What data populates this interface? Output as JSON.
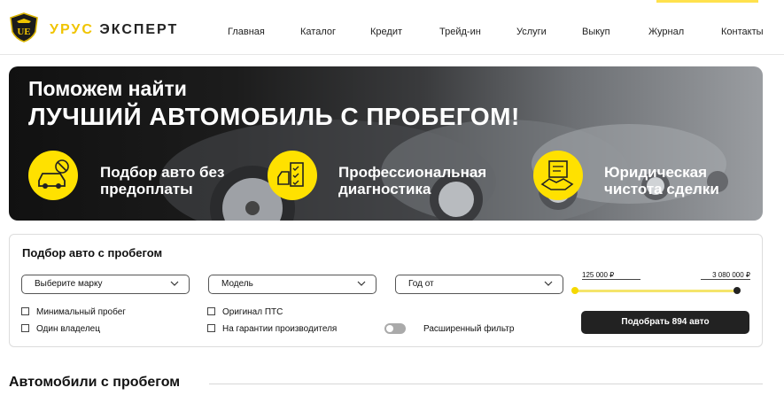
{
  "brand": {
    "part1": "УРУС",
    "part2": "ЭКСПЕРТ",
    "logo_text": "URUS EXPERT"
  },
  "nav": [
    "Главная",
    "Каталог",
    "Кредит",
    "Трейд-ин",
    "Услуги",
    "Выкуп",
    "Журнал",
    "Контакты"
  ],
  "hero": {
    "line1": "Поможем найти",
    "line2": "ЛУЧШИЙ АВТОМОБИЛЬ С ПРОБЕГОМ!",
    "features": [
      {
        "icon": "car-no-money-icon",
        "text": "Подбор авто без предоплаты"
      },
      {
        "icon": "diagnostics-checklist-icon",
        "text": "Профессиональная диагностика"
      },
      {
        "icon": "legal-handshake-icon",
        "text": "Юридическая чистота сделки"
      }
    ]
  },
  "filter": {
    "title": "Подбор авто с пробегом",
    "brand_select": "Выберите марку",
    "model_select": "Модель",
    "year_select": "Год от",
    "price_min": "125 000 ₽",
    "price_max": "3 080 000 ₽",
    "checkboxes": [
      "Минимальный пробег",
      "Один владелец",
      "Оригинал ПТС",
      "На гарантии производителя"
    ],
    "extended_filter": "Расширенный фильтр",
    "submit_label": "Подобрать 894 авто"
  },
  "section": {
    "title": "Автомобили с пробегом"
  },
  "colors": {
    "accent": "#ffe100",
    "dark": "#222222"
  }
}
